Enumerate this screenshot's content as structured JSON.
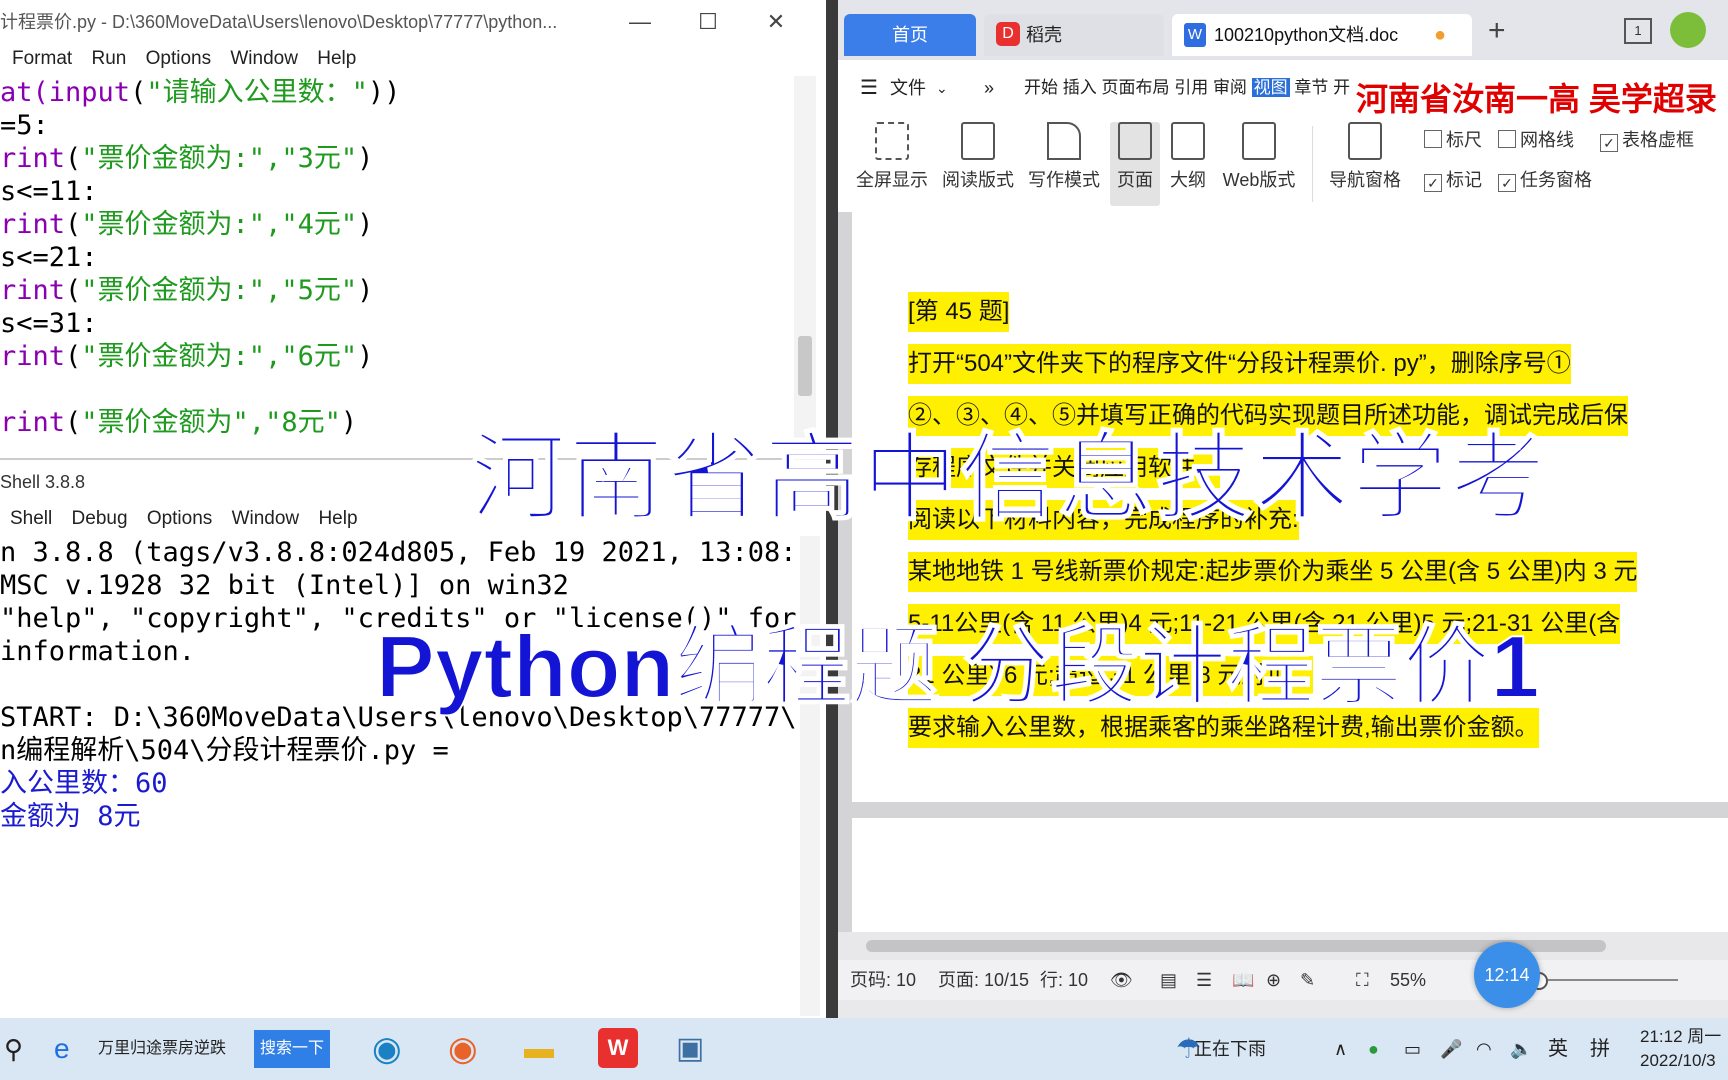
{
  "editor": {
    "title": "计程票价.py - D:\\360MoveData\\Users\\lenovo\\Desktop\\77777\\python...",
    "menu": [
      "Format",
      "Run",
      "Options",
      "Window",
      "Help"
    ],
    "lines": [
      [
        "at(",
        "input",
        "(",
        "\"请输入公里数：\"",
        "))"
      ],
      [
        "=5:"
      ],
      [
        "rint",
        "(",
        "\"票价金额为:\",\"3元\"",
        ")"
      ],
      [
        "s<=11:"
      ],
      [
        "rint",
        "(",
        "\"票价金额为:\",\"4元\"",
        ")"
      ],
      [
        "s<=21:"
      ],
      [
        "rint",
        "(",
        "\"票价金额为:\",\"5元\"",
        ")"
      ],
      [
        "s<=31:"
      ],
      [
        "rint",
        "(",
        "\"票价金额为:\",\"6元\"",
        ")"
      ],
      [
        ""
      ],
      [
        "rint",
        "(",
        "\"票价金额为\",\"8元\"",
        ")"
      ]
    ]
  },
  "shell": {
    "title": "Shell 3.8.8",
    "menu": [
      "Shell",
      "Debug",
      "Options",
      "Window",
      "Help"
    ],
    "out1": "n 3.8.8 (tags/v3.8.8:024d805, Feb 19 2021, 13:08:",
    "out2": "MSC v.1928 32 bit (Intel)] on win32",
    "out3": "\"help\", \"copyright\", \"credits\" or \"license()\" for",
    "out4": "information.",
    "out5": "START: D:\\360MoveData\\Users\\lenovo\\Desktop\\77777\\",
    "out6": "n编程解析\\504\\分段计程票价.py =",
    "out7": "入公里数：60",
    "out8": "金额为 8元"
  },
  "wps": {
    "tabs": {
      "home": "首页",
      "daoke": "稻壳",
      "doc": "100210python文档.doc"
    },
    "file_menu": "文件",
    "ribbon_tabs": [
      "开始",
      "插入",
      "页面布局",
      "引用",
      "审阅",
      "视图",
      "章节",
      "开"
    ],
    "ribbon_active": "视图",
    "buttons": [
      "全屏显示",
      "阅读版式",
      "写作模式",
      "页面",
      "大纲",
      "Web版式",
      "导航窗格"
    ],
    "checks": [
      {
        "label": "标尺",
        "checked": false
      },
      {
        "label": "网格线",
        "checked": false
      },
      {
        "label": "表格虚框",
        "checked": true
      },
      {
        "label": "标记",
        "checked": true
      },
      {
        "label": "任务窗格",
        "checked": true
      }
    ],
    "doc": {
      "l1": "[第 45 题]",
      "l2": "打开“504”文件夹下的程序文件“分段计程票价. py”，删除序号①",
      "l3": "②、③、④、⑤并填写正确的代码实现题目所述功能，调试完成后保",
      "l4": "存程序文件并关闭应用软件。",
      "l5": "阅读以下材料内容，完成程序的补充:",
      "l6": "某地地铁 1 号线新票价规定:起步票价为乘坐 5 公里(含 5 公里)内 3 元",
      "l7": "5-11公里(含 11 公里)4 元;11-21 公里(含 21 公里)5 元;21-31 公里(含",
      "l8": "31 公里) 6 元;超过 31 公里 8 元封顶。",
      "l9": "要求输入公里数，根据乘客的乘坐路程计费,输出票价金额。"
    },
    "status": {
      "page_no": "页码: 10",
      "pages": "页面: 10/15",
      "row": "行: 10",
      "zoom": "55%",
      "timer": "12:14"
    }
  },
  "overlay": {
    "title": "河南省高中信息技术学考",
    "subtitle": "Python编程题 分段计程票价1",
    "red": "河南省汝南一高 吴学超录"
  },
  "taskbar": {
    "news": "万里归途票房逆跌",
    "search": "搜索一下",
    "weather": "正在下雨",
    "lang": "英",
    "ime": "拼",
    "time": "21:12 周一",
    "date": "2022/10/3"
  }
}
